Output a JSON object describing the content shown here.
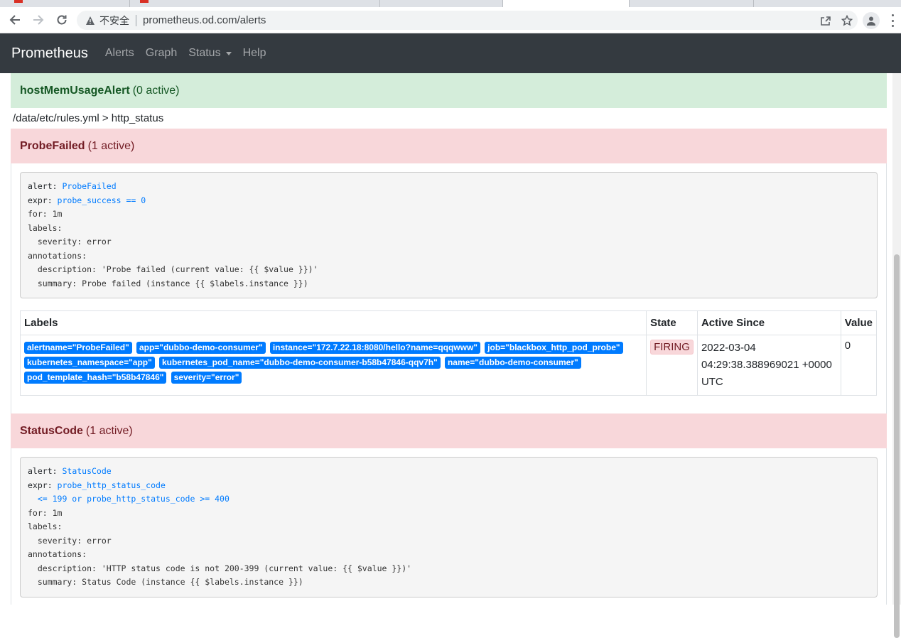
{
  "browser": {
    "insecure_label": "不安全",
    "url": "prometheus.od.com/alerts"
  },
  "navbar": {
    "brand": "Prometheus",
    "links": [
      "Alerts",
      "Graph",
      "Status",
      "Help"
    ]
  },
  "groups": [
    {
      "name": "hostMemUsageAlert",
      "count": "(0 active)",
      "state": "ok"
    }
  ],
  "file_path": "/data/etc/rules.yml > http_status",
  "rules": [
    {
      "name": "ProbeFailed",
      "count": "(1 active)",
      "definition": {
        "alert_key": "alert: ",
        "alert_val": "ProbeFailed",
        "expr_key": "expr: ",
        "expr_val": "probe_success == 0",
        "rest": "for: 1m\nlabels:\n  severity: error\nannotations:\n  description: 'Probe failed (current value: {{ $value }})'\n  summary: Probe failed (instance {{ $labels.instance }})"
      },
      "table": {
        "headers": [
          "Labels",
          "State",
          "Active Since",
          "Value"
        ],
        "labels": [
          "alertname=\"ProbeFailed\"",
          "app=\"dubbo-demo-consumer\"",
          "instance=\"172.7.22.18:8080/hello?name=qqqwww\"",
          "job=\"blackbox_http_pod_probe\"",
          "kubernetes_namespace=\"app\"",
          "kubernetes_pod_name=\"dubbo-demo-consumer-b58b47846-qqv7h\"",
          "name=\"dubbo-demo-consumer\"",
          "pod_template_hash=\"b58b47846\"",
          "severity=\"error\""
        ],
        "state": "FIRING",
        "active_since": [
          "2022-03-04",
          "04:29:38.388969021 +0000",
          "UTC"
        ],
        "value": "0"
      }
    },
    {
      "name": "StatusCode",
      "count": "(1 active)",
      "definition": {
        "alert_key": "alert: ",
        "alert_val": "StatusCode",
        "expr_key": "expr: ",
        "expr_val": "probe_http_status_code\n  <= 199 or probe_http_status_code >= 400",
        "rest": "for: 1m\nlabels:\n  severity: error\nannotations:\n  description: 'HTTP status code is not 200-399 (current value: {{ $value }})'\n  summary: Status Code (instance {{ $labels.instance }})"
      }
    }
  ]
}
